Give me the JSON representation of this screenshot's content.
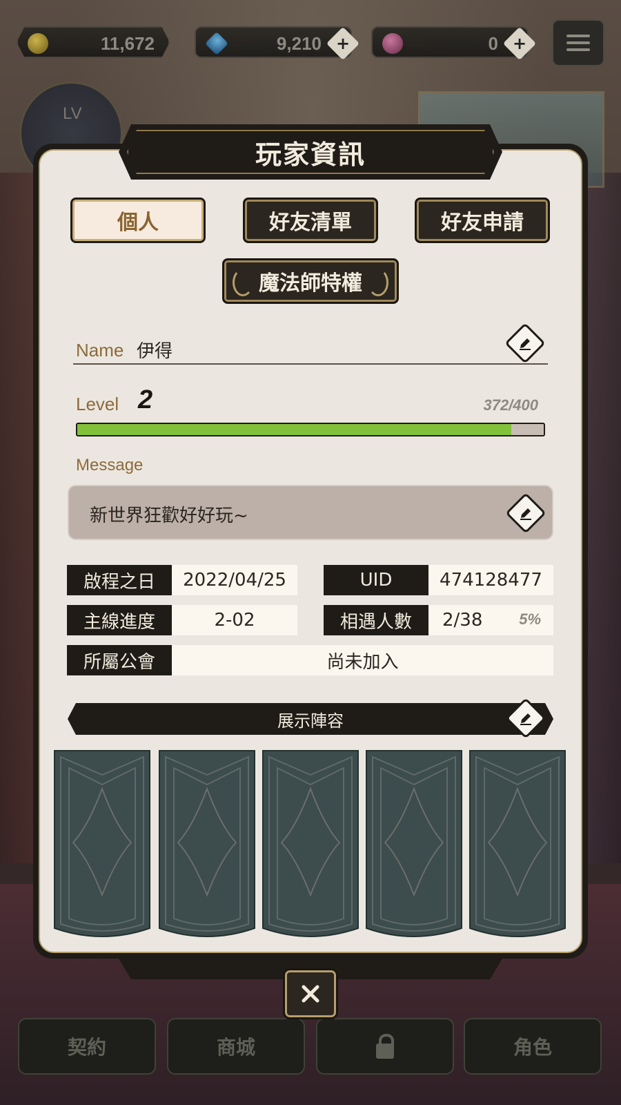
{
  "currencies": {
    "gold": {
      "value": "11,672",
      "icon": "gold-coin-icon"
    },
    "gem": {
      "value": "9,210",
      "icon": "diamond-icon"
    },
    "pink": {
      "value": "0",
      "icon": "pink-gem-icon"
    },
    "plus_symbol": "+"
  },
  "background": {
    "lv_label": "LV"
  },
  "modal": {
    "title": "玩家資訊",
    "tabs": [
      {
        "label": "個人",
        "active": true
      },
      {
        "label": "好友清單",
        "active": false
      },
      {
        "label": "好友申請",
        "active": false
      }
    ],
    "special_tab": "魔法師特權",
    "name_label": "Name",
    "name_value": "伊得",
    "level_label": "Level",
    "level_value": "2",
    "exp_text": "372/400",
    "exp_current": 372,
    "exp_max": 400,
    "message_label": "Message",
    "message_text": "新世界狂歡好好玩~",
    "info": {
      "start_date_key": "啟程之日",
      "start_date_val": "2022/04/25",
      "uid_key": "UID",
      "uid_val": "474128477",
      "story_key": "主線進度",
      "story_val": "2-02",
      "met_key": "相遇人數",
      "met_val": "2/38",
      "met_pct": "5%",
      "guild_key": "所屬公會",
      "guild_val": "尚未加入"
    },
    "showcase_label": "展示陣容",
    "close_symbol": "✕"
  },
  "bottom_nav": {
    "items": [
      {
        "label": "契約"
      },
      {
        "label": "商城"
      },
      {
        "label": "",
        "locked": true
      },
      {
        "label": "角色"
      }
    ]
  },
  "colors": {
    "panel_bg": "#ebe7e0",
    "dark_plate": "#1f1b17",
    "gold_trim": "#b59f6c",
    "label_brown": "#8e6a3a",
    "exp_green": "#82c23b"
  }
}
